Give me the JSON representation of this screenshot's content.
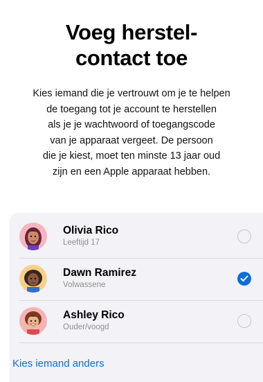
{
  "title_lines": [
    "Voeg herstel-",
    "contact toe"
  ],
  "description_lines": [
    "Kies iemand die je vertrouwt om je te helpen",
    "de toegang tot je account te herstellen",
    "als je je wachtwoord of toegangscode",
    "van je apparaat vergeet. De persoon",
    "die je kiest, moet ten minste 13 jaar oud",
    "zijn en een Apple apparaat hebben."
  ],
  "contacts": [
    {
      "name": "Olivia Rico",
      "subtitle": "Leeftijd 17",
      "selected": false,
      "avatar_bg": "#f3b6c0"
    },
    {
      "name": "Dawn Ramirez",
      "subtitle": "Volwassene",
      "selected": true,
      "avatar_bg": "#f7d08a"
    },
    {
      "name": "Ashley Rico",
      "subtitle": "Ouder/voogd",
      "selected": false,
      "avatar_bg": "#f6b3b3"
    }
  ],
  "choose_other_label": "Kies iemand anders",
  "colors": {
    "accent": "#0a6fd8",
    "card_background": "#f2f2f7",
    "secondary_text": "#8e8e93"
  }
}
